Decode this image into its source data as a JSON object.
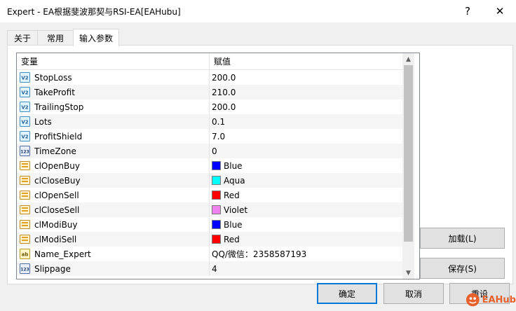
{
  "window": {
    "title": "Expert - EA根据斐波那契与RSI-EA[EAHubu]",
    "help_glyph": "?",
    "close_glyph": "✕"
  },
  "tabs": [
    {
      "label": "关于",
      "active": false
    },
    {
      "label": "常用",
      "active": false
    },
    {
      "label": "输入参数",
      "active": true
    }
  ],
  "grid": {
    "columns": [
      "变量",
      "赋值"
    ],
    "rows": [
      {
        "name": "StopLoss",
        "value": "200.0",
        "icon": "double-value-icon"
      },
      {
        "name": "TakeProfit",
        "value": "210.0",
        "icon": "double-value-icon"
      },
      {
        "name": "TrailingStop",
        "value": "200.0",
        "icon": "double-value-icon"
      },
      {
        "name": "Lots",
        "value": "0.1",
        "icon": "double-value-icon"
      },
      {
        "name": "ProfitShield",
        "value": "7.0",
        "icon": "double-value-icon"
      },
      {
        "name": "TimeZone",
        "value": "0",
        "icon": "integer-value-icon"
      },
      {
        "name": "clOpenBuy",
        "value": "Blue",
        "icon": "color-value-icon",
        "color": "#0000ff"
      },
      {
        "name": "clCloseBuy",
        "value": "Aqua",
        "icon": "color-value-icon",
        "color": "#00ffff"
      },
      {
        "name": "clOpenSell",
        "value": "Red",
        "icon": "color-value-icon",
        "color": "#ff0000"
      },
      {
        "name": "clCloseSell",
        "value": "Violet",
        "icon": "color-value-icon",
        "color": "#ee82ee"
      },
      {
        "name": "clModiBuy",
        "value": "Blue",
        "icon": "color-value-icon",
        "color": "#0000ff"
      },
      {
        "name": "clModiSell",
        "value": "Red",
        "icon": "color-value-icon",
        "color": "#ff0000"
      },
      {
        "name": "Name_Expert",
        "value": "QQ/微信：2358587193",
        "icon": "string-value-icon"
      },
      {
        "name": "Slippage",
        "value": "4",
        "icon": "integer-value-icon"
      }
    ]
  },
  "side_buttons": {
    "load": "加载(L)",
    "save": "保存(S)"
  },
  "footer_buttons": {
    "ok": "确定",
    "cancel": "取消",
    "reset": "重设"
  },
  "watermark": {
    "text": "EAHub"
  },
  "colors": {
    "accent": "#0078d7",
    "watermark": "#e8612c"
  }
}
